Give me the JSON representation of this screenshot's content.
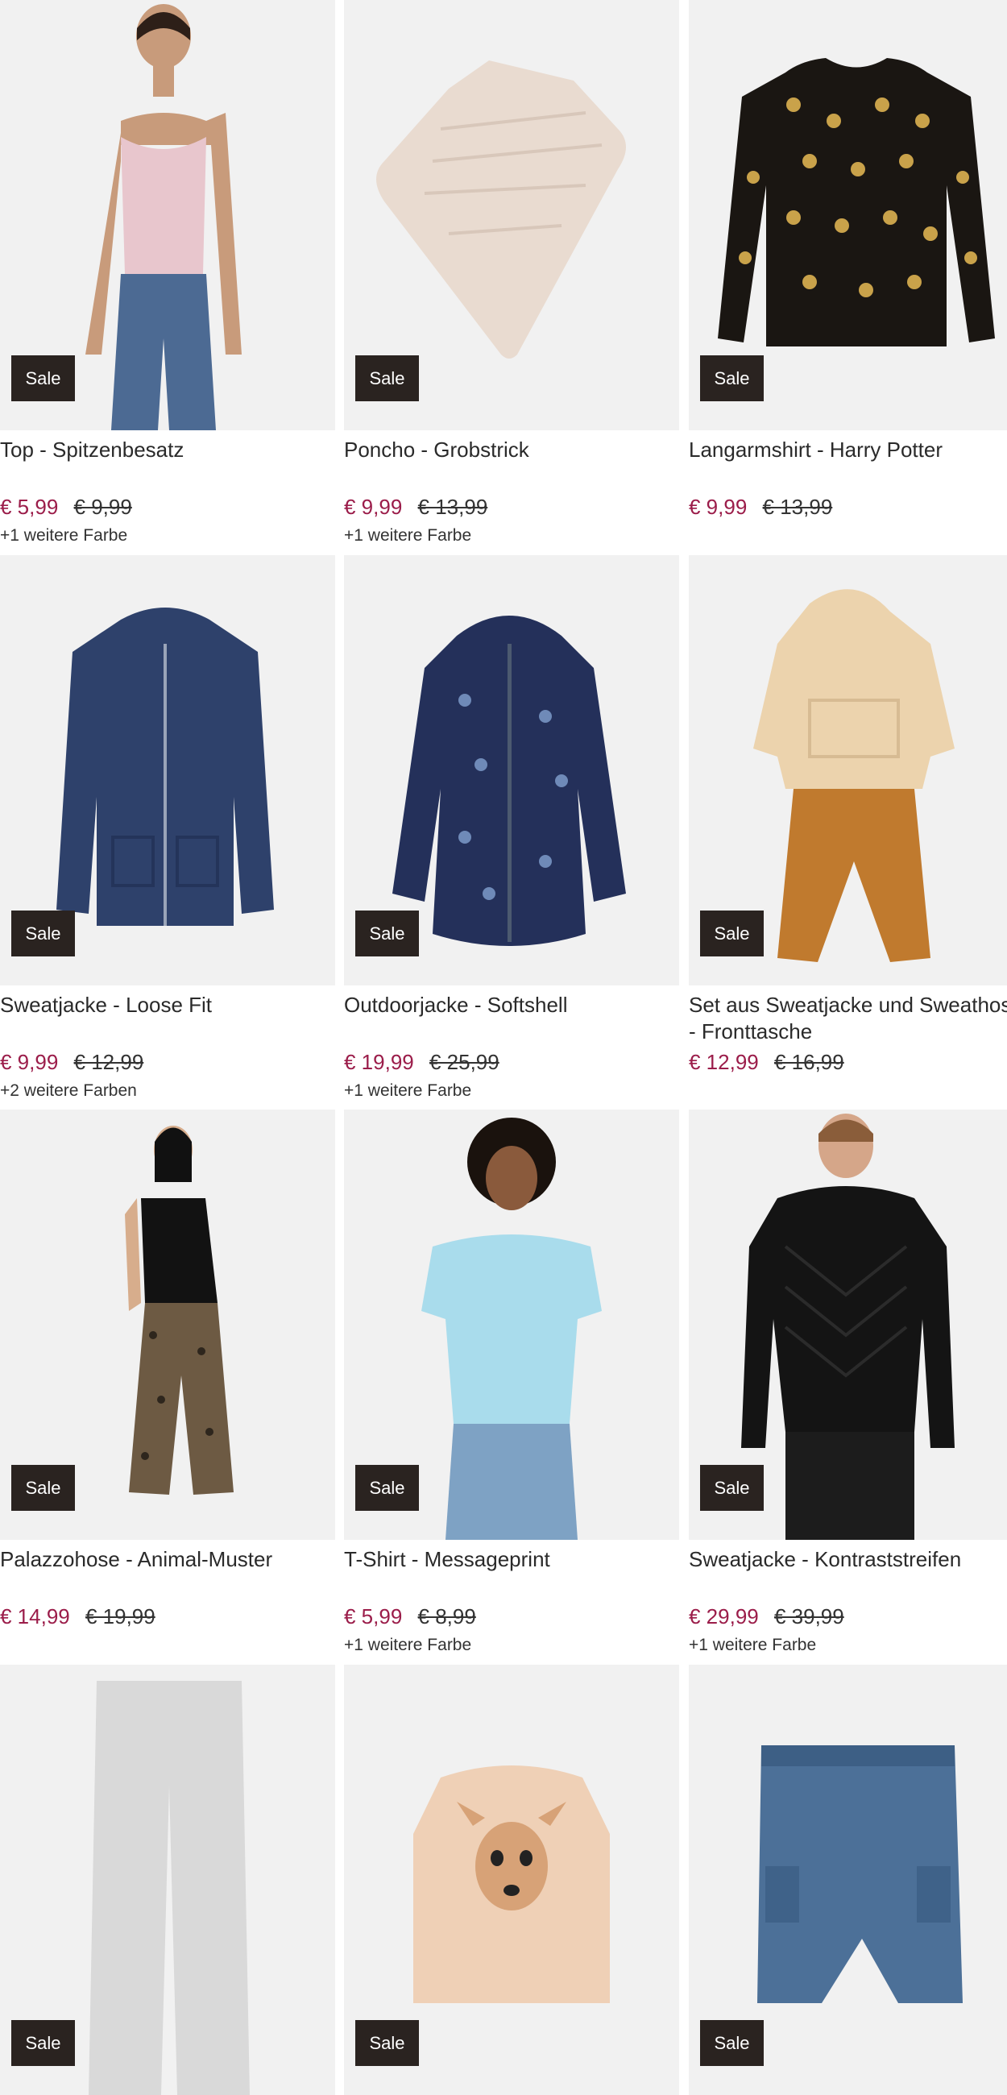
{
  "products": [
    {
      "title": "Top - Spitzenbesatz",
      "badge": "Sale",
      "price": "€ 5,99",
      "old_price": "€ 9,99",
      "colors": "+1 weitere Farbe"
    },
    {
      "title": "Poncho - Grobstrick",
      "badge": "Sale",
      "price": "€ 9,99",
      "old_price": "€ 13,99",
      "colors": "+1 weitere Farbe"
    },
    {
      "title": "Langarmshirt - Harry Potter",
      "badge": "Sale",
      "price": "€ 9,99",
      "old_price": "€ 13,99",
      "colors": ""
    },
    {
      "title": "Sweatjacke - Loose Fit",
      "badge": "Sale",
      "price": "€ 9,99",
      "old_price": "€ 12,99",
      "colors": "+2 weitere Farben"
    },
    {
      "title": "Outdoorjacke - Softshell",
      "badge": "Sale",
      "price": "€ 19,99",
      "old_price": "€ 25,99",
      "colors": "+1 weitere Farbe"
    },
    {
      "title": "Set aus Sweatjacke und Sweathose - Fronttasche",
      "badge": "Sale",
      "price": "€ 12,99",
      "old_price": "€ 16,99",
      "colors": ""
    },
    {
      "title": "Palazzohose - Animal-Muster",
      "badge": "Sale",
      "price": "€ 14,99",
      "old_price": "€ 19,99",
      "colors": ""
    },
    {
      "title": "T-Shirt - Messageprint",
      "badge": "Sale",
      "price": "€ 5,99",
      "old_price": "€ 8,99",
      "colors": "+1 weitere Farbe"
    },
    {
      "title": "Sweatjacke - Kontraststreifen",
      "badge": "Sale",
      "price": "€ 29,99",
      "old_price": "€ 39,99",
      "colors": "+1 weitere Farbe"
    },
    {
      "title": "",
      "badge": "Sale",
      "price": "",
      "old_price": "",
      "colors": ""
    },
    {
      "title": "",
      "badge": "Sale",
      "price": "",
      "old_price": "",
      "colors": ""
    },
    {
      "title": "",
      "badge": "Sale",
      "price": "",
      "old_price": "",
      "colors": ""
    }
  ],
  "colors": {
    "sale_price": "#9b1d4a",
    "badge_bg": "#2a2320",
    "image_bg": "#f1f1f1"
  }
}
